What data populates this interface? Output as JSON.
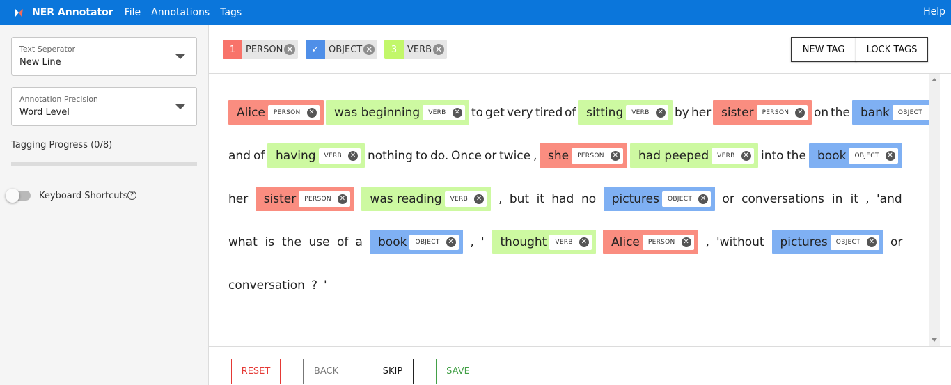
{
  "app": {
    "title": "NER Annotator",
    "menu": [
      "File",
      "Annotations",
      "Tags"
    ],
    "help_label": "Help"
  },
  "sidebar": {
    "text_separator": {
      "label": "Text Seperator",
      "value": "New Line"
    },
    "annotation_precision": {
      "label": "Annotation Precision",
      "value": "Word Level"
    },
    "progress": {
      "label": "Tagging Progress (0/8)",
      "fraction": 0
    },
    "keyboard_shortcuts": {
      "label": "Keyboard Shortcuts",
      "enabled": false,
      "help_icon": "?"
    }
  },
  "tags": [
    {
      "key": "1",
      "name": "PERSON",
      "color": "#f8736a",
      "selected": false
    },
    {
      "key": "✓",
      "name": "OBJECT",
      "color": "#4f8fe8",
      "selected": true
    },
    {
      "key": "3",
      "name": "VERB",
      "color": "#c2f76a",
      "selected": false
    }
  ],
  "tag_actions": {
    "new_tag": "NEW TAG",
    "lock_tags": "LOCK TAGS"
  },
  "remove_symbol": "✕",
  "colors": {
    "PERSON": "#fa8d80",
    "OBJECT": "#7fb0f3",
    "VERB": "#cdf9a1",
    "accent": "#0b76db"
  },
  "document": {
    "lines": [
      [
        {
          "ent": "Alice",
          "label": "PERSON"
        },
        {
          "ent": "was beginning",
          "label": "VERB"
        },
        {
          "text": "to"
        },
        {
          "text": "get"
        },
        {
          "text": "very"
        },
        {
          "text": "tired"
        },
        {
          "text": "of"
        },
        {
          "ent": "sitting",
          "label": "VERB"
        },
        {
          "text": "by"
        },
        {
          "text": "her"
        },
        {
          "ent": "sister",
          "label": "PERSON"
        },
        {
          "text": "on"
        },
        {
          "text": "the"
        },
        {
          "ent": "bank",
          "label": "OBJECT"
        }
      ],
      [
        {
          "text": "and"
        },
        {
          "text": "of"
        },
        {
          "ent": "having",
          "label": "VERB"
        },
        {
          "text": "nothing"
        },
        {
          "text": "to"
        },
        {
          "text": "do."
        },
        {
          "text": "Once"
        },
        {
          "text": "or"
        },
        {
          "text": "twice"
        },
        {
          "text": ","
        },
        {
          "ent": "she",
          "label": "PERSON"
        },
        {
          "ent": "had peeped",
          "label": "VERB"
        },
        {
          "text": "into"
        },
        {
          "text": "the"
        },
        {
          "ent": "book",
          "label": "OBJECT"
        }
      ],
      [
        {
          "text": "her"
        },
        {
          "ent": "sister",
          "label": "PERSON"
        },
        {
          "ent": "was reading",
          "label": "VERB"
        },
        {
          "text": ","
        },
        {
          "text": "but"
        },
        {
          "text": "it"
        },
        {
          "text": "had"
        },
        {
          "text": "no"
        },
        {
          "ent": "pictures",
          "label": "OBJECT"
        },
        {
          "text": "or"
        },
        {
          "text": "conversations"
        },
        {
          "text": "in"
        },
        {
          "text": "it"
        },
        {
          "text": ","
        },
        {
          "text": "'and"
        }
      ],
      [
        {
          "text": "what"
        },
        {
          "text": "is"
        },
        {
          "text": "the"
        },
        {
          "text": "use"
        },
        {
          "text": "of"
        },
        {
          "text": "a"
        },
        {
          "ent": "book",
          "label": "OBJECT"
        },
        {
          "text": ","
        },
        {
          "text": "'"
        },
        {
          "ent": "thought",
          "label": "VERB"
        },
        {
          "ent": "Alice",
          "label": "PERSON"
        },
        {
          "text": ","
        },
        {
          "text": "'without"
        },
        {
          "ent": "pictures",
          "label": "OBJECT"
        },
        {
          "text": "or"
        }
      ],
      [
        {
          "text": "conversation"
        },
        {
          "text": "?"
        },
        {
          "text": "'"
        }
      ]
    ]
  },
  "footer": {
    "reset": "RESET",
    "back": "BACK",
    "skip": "SKIP",
    "save": "SAVE"
  }
}
